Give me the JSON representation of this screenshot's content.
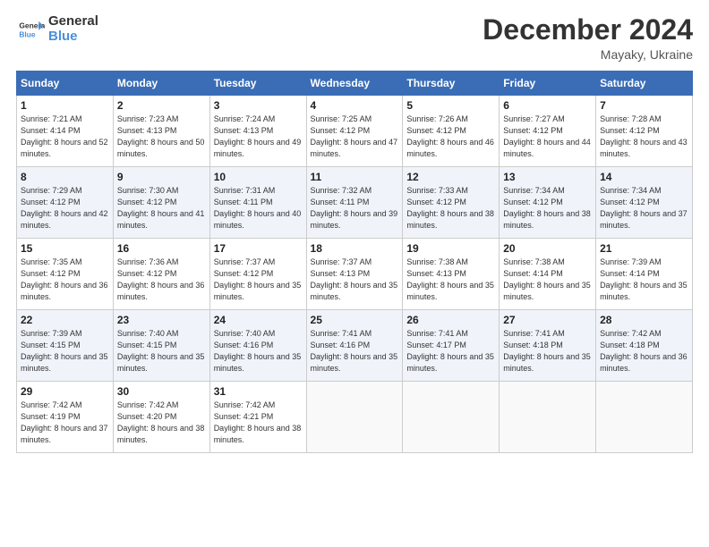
{
  "header": {
    "logo_line1": "General",
    "logo_line2": "Blue",
    "month_title": "December 2024",
    "location": "Mayaky, Ukraine"
  },
  "weekdays": [
    "Sunday",
    "Monday",
    "Tuesday",
    "Wednesday",
    "Thursday",
    "Friday",
    "Saturday"
  ],
  "weeks": [
    [
      {
        "day": "1",
        "sunrise": "Sunrise: 7:21 AM",
        "sunset": "Sunset: 4:14 PM",
        "daylight": "Daylight: 8 hours and 52 minutes."
      },
      {
        "day": "2",
        "sunrise": "Sunrise: 7:23 AM",
        "sunset": "Sunset: 4:13 PM",
        "daylight": "Daylight: 8 hours and 50 minutes."
      },
      {
        "day": "3",
        "sunrise": "Sunrise: 7:24 AM",
        "sunset": "Sunset: 4:13 PM",
        "daylight": "Daylight: 8 hours and 49 minutes."
      },
      {
        "day": "4",
        "sunrise": "Sunrise: 7:25 AM",
        "sunset": "Sunset: 4:12 PM",
        "daylight": "Daylight: 8 hours and 47 minutes."
      },
      {
        "day": "5",
        "sunrise": "Sunrise: 7:26 AM",
        "sunset": "Sunset: 4:12 PM",
        "daylight": "Daylight: 8 hours and 46 minutes."
      },
      {
        "day": "6",
        "sunrise": "Sunrise: 7:27 AM",
        "sunset": "Sunset: 4:12 PM",
        "daylight": "Daylight: 8 hours and 44 minutes."
      },
      {
        "day": "7",
        "sunrise": "Sunrise: 7:28 AM",
        "sunset": "Sunset: 4:12 PM",
        "daylight": "Daylight: 8 hours and 43 minutes."
      }
    ],
    [
      {
        "day": "8",
        "sunrise": "Sunrise: 7:29 AM",
        "sunset": "Sunset: 4:12 PM",
        "daylight": "Daylight: 8 hours and 42 minutes."
      },
      {
        "day": "9",
        "sunrise": "Sunrise: 7:30 AM",
        "sunset": "Sunset: 4:12 PM",
        "daylight": "Daylight: 8 hours and 41 minutes."
      },
      {
        "day": "10",
        "sunrise": "Sunrise: 7:31 AM",
        "sunset": "Sunset: 4:11 PM",
        "daylight": "Daylight: 8 hours and 40 minutes."
      },
      {
        "day": "11",
        "sunrise": "Sunrise: 7:32 AM",
        "sunset": "Sunset: 4:11 PM",
        "daylight": "Daylight: 8 hours and 39 minutes."
      },
      {
        "day": "12",
        "sunrise": "Sunrise: 7:33 AM",
        "sunset": "Sunset: 4:12 PM",
        "daylight": "Daylight: 8 hours and 38 minutes."
      },
      {
        "day": "13",
        "sunrise": "Sunrise: 7:34 AM",
        "sunset": "Sunset: 4:12 PM",
        "daylight": "Daylight: 8 hours and 38 minutes."
      },
      {
        "day": "14",
        "sunrise": "Sunrise: 7:34 AM",
        "sunset": "Sunset: 4:12 PM",
        "daylight": "Daylight: 8 hours and 37 minutes."
      }
    ],
    [
      {
        "day": "15",
        "sunrise": "Sunrise: 7:35 AM",
        "sunset": "Sunset: 4:12 PM",
        "daylight": "Daylight: 8 hours and 36 minutes."
      },
      {
        "day": "16",
        "sunrise": "Sunrise: 7:36 AM",
        "sunset": "Sunset: 4:12 PM",
        "daylight": "Daylight: 8 hours and 36 minutes."
      },
      {
        "day": "17",
        "sunrise": "Sunrise: 7:37 AM",
        "sunset": "Sunset: 4:12 PM",
        "daylight": "Daylight: 8 hours and 35 minutes."
      },
      {
        "day": "18",
        "sunrise": "Sunrise: 7:37 AM",
        "sunset": "Sunset: 4:13 PM",
        "daylight": "Daylight: 8 hours and 35 minutes."
      },
      {
        "day": "19",
        "sunrise": "Sunrise: 7:38 AM",
        "sunset": "Sunset: 4:13 PM",
        "daylight": "Daylight: 8 hours and 35 minutes."
      },
      {
        "day": "20",
        "sunrise": "Sunrise: 7:38 AM",
        "sunset": "Sunset: 4:14 PM",
        "daylight": "Daylight: 8 hours and 35 minutes."
      },
      {
        "day": "21",
        "sunrise": "Sunrise: 7:39 AM",
        "sunset": "Sunset: 4:14 PM",
        "daylight": "Daylight: 8 hours and 35 minutes."
      }
    ],
    [
      {
        "day": "22",
        "sunrise": "Sunrise: 7:39 AM",
        "sunset": "Sunset: 4:15 PM",
        "daylight": "Daylight: 8 hours and 35 minutes."
      },
      {
        "day": "23",
        "sunrise": "Sunrise: 7:40 AM",
        "sunset": "Sunset: 4:15 PM",
        "daylight": "Daylight: 8 hours and 35 minutes."
      },
      {
        "day": "24",
        "sunrise": "Sunrise: 7:40 AM",
        "sunset": "Sunset: 4:16 PM",
        "daylight": "Daylight: 8 hours and 35 minutes."
      },
      {
        "day": "25",
        "sunrise": "Sunrise: 7:41 AM",
        "sunset": "Sunset: 4:16 PM",
        "daylight": "Daylight: 8 hours and 35 minutes."
      },
      {
        "day": "26",
        "sunrise": "Sunrise: 7:41 AM",
        "sunset": "Sunset: 4:17 PM",
        "daylight": "Daylight: 8 hours and 35 minutes."
      },
      {
        "day": "27",
        "sunrise": "Sunrise: 7:41 AM",
        "sunset": "Sunset: 4:18 PM",
        "daylight": "Daylight: 8 hours and 35 minutes."
      },
      {
        "day": "28",
        "sunrise": "Sunrise: 7:42 AM",
        "sunset": "Sunset: 4:18 PM",
        "daylight": "Daylight: 8 hours and 36 minutes."
      }
    ],
    [
      {
        "day": "29",
        "sunrise": "Sunrise: 7:42 AM",
        "sunset": "Sunset: 4:19 PM",
        "daylight": "Daylight: 8 hours and 37 minutes."
      },
      {
        "day": "30",
        "sunrise": "Sunrise: 7:42 AM",
        "sunset": "Sunset: 4:20 PM",
        "daylight": "Daylight: 8 hours and 38 minutes."
      },
      {
        "day": "31",
        "sunrise": "Sunrise: 7:42 AM",
        "sunset": "Sunset: 4:21 PM",
        "daylight": "Daylight: 8 hours and 38 minutes."
      },
      null,
      null,
      null,
      null
    ]
  ]
}
